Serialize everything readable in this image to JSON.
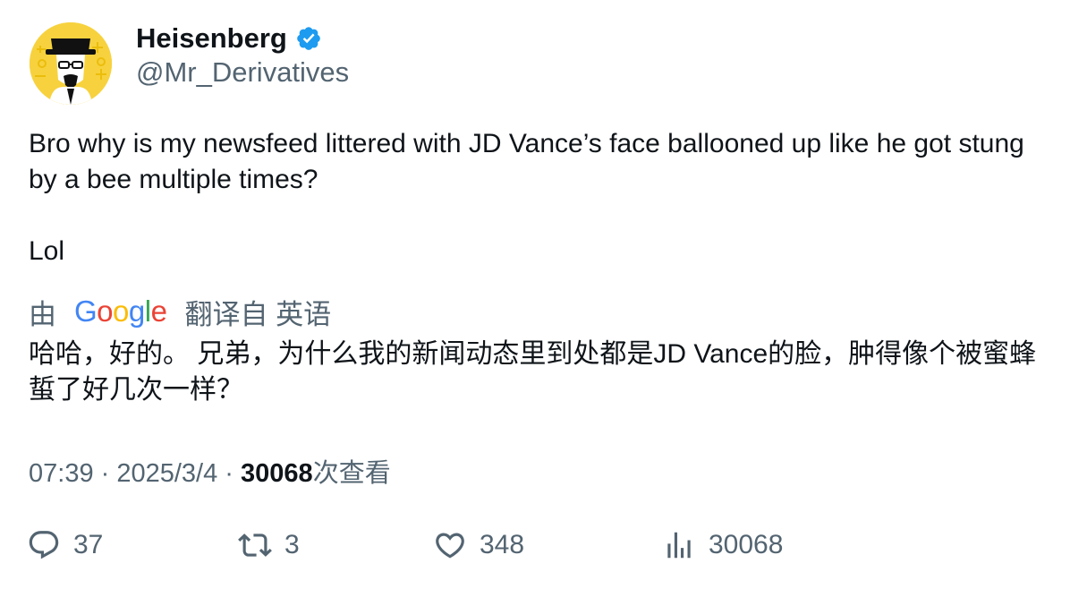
{
  "author": {
    "display_name": "Heisenberg",
    "handle": "@Mr_Derivatives",
    "verified": true,
    "verified_color": "#1d9bf0",
    "avatar_bg": "#f7d23e"
  },
  "tweet": {
    "paragraphs": [
      "Bro why is my newsfeed littered with JD Vance’s face ballooned up like he got stung by a bee multiple times?",
      "Lol"
    ]
  },
  "translation": {
    "prefix": "由",
    "provider_letters": [
      "G",
      "o",
      "o",
      "g",
      "l",
      "e"
    ],
    "suffix": "翻译自 英语",
    "text": "哈哈，好的。 兄弟，为什么我的新闻动态里到处都是JD Vance的脸，肿得像个被蜜蜂蜇了好几次一样？"
  },
  "meta": {
    "time": "07:39",
    "separator": " · ",
    "date": "2025/3/4",
    "views_count": "30068",
    "views_label": "次查看"
  },
  "actions": {
    "reply_count": "37",
    "retweet_count": "3",
    "like_count": "348",
    "views_count": "30068",
    "icons": [
      "reply-icon",
      "retweet-icon",
      "like-icon",
      "views-icon"
    ]
  }
}
